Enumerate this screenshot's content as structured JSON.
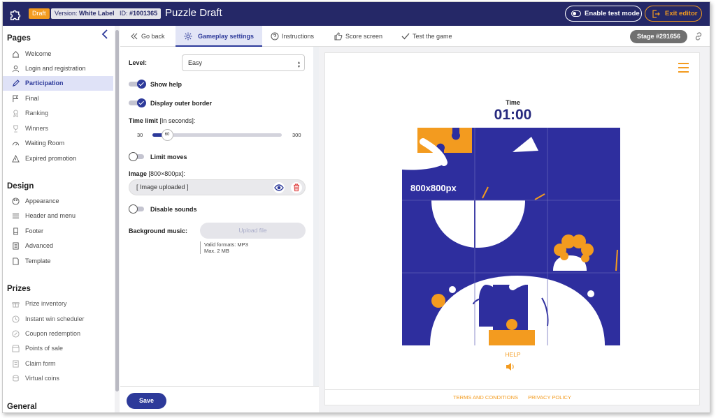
{
  "header": {
    "badge_draft": "Draft",
    "version_label": "Version:",
    "version_value": "White Label",
    "id_label": "ID:",
    "id_value": "#1001365",
    "title": "Puzzle Draft",
    "test_mode_label": "Enable test mode",
    "exit_label": "Exit editor"
  },
  "sidebar": {
    "sections": [
      {
        "heading": "Pages",
        "items": [
          "Welcome",
          "Login and registration",
          "Participation",
          "Final",
          "Ranking",
          "Winners",
          "Waiting Room",
          "Expired promotion"
        ]
      },
      {
        "heading": "Design",
        "items": [
          "Appearance",
          "Header and menu",
          "Footer",
          "Advanced",
          "Template"
        ]
      },
      {
        "heading": "Prizes",
        "items": [
          "Prize inventory",
          "Instant win scheduler",
          "Coupon redemption",
          "Points of sale",
          "Claim form",
          "Virtual coins"
        ]
      },
      {
        "heading": "General",
        "items": []
      }
    ],
    "active_item": "Participation"
  },
  "tabs": {
    "items": [
      "Go back",
      "Gameplay settings",
      "Instructions",
      "Score screen",
      "Test the game"
    ],
    "active": "Gameplay settings",
    "stage": "Stage #291656"
  },
  "settings": {
    "level_label": "Level:",
    "level_value": "Easy",
    "show_help_label": "Show help",
    "show_help_on": true,
    "outer_border_label": "Display outer border",
    "outer_border_on": true,
    "time_limit_label": "Time limit",
    "time_limit_unit": "[In seconds]:",
    "slider_min": "30",
    "slider_max": "300",
    "slider_value": "60",
    "limit_moves_label": "Limit moves",
    "limit_moves_on": false,
    "image_label": "Image",
    "image_size": "[800×800px]:",
    "image_value": "[ Image uploaded ]",
    "disable_sounds_label": "Disable sounds",
    "disable_sounds_on": false,
    "bg_music_label": "Background music:",
    "upload_label": "Upload file",
    "formats_line1": "Valid formats: MP3",
    "formats_line2": "Max. 2 MB",
    "save_label": "Save"
  },
  "preview": {
    "time_label": "Time",
    "time_value": "01:00",
    "image_caption": "800x800px",
    "help_label": "HELP",
    "footer_terms": "TERMS AND CONDITIONS",
    "footer_privacy": "PRIVACY POLICY"
  },
  "colors": {
    "navy": "#252867",
    "accent": "#2d3a9a",
    "orange": "#f39b1f",
    "puzzle_blue": "#2e2e9e"
  }
}
